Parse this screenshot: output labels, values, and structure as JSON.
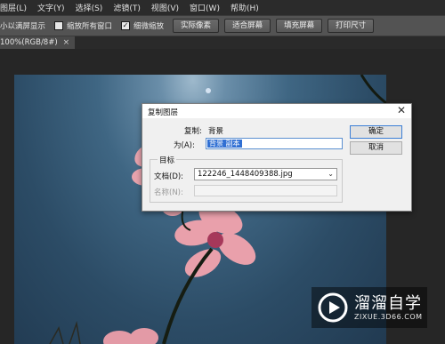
{
  "menu": {
    "items": [
      "图层(L)",
      "文字(Y)",
      "选择(S)",
      "滤镜(T)",
      "视图(V)",
      "窗口(W)",
      "帮助(H)"
    ]
  },
  "options_bar": {
    "scroll_all_label": "小以满屏显示",
    "zoom_all_windows_label": "缩放所有窗口",
    "zoom_all_windows_checked": false,
    "scrubby_zoom_label": "细微缩放",
    "scrubby_zoom_checked": true,
    "buttons": [
      "实际像素",
      "适合屏幕",
      "填充屏幕",
      "打印尺寸"
    ]
  },
  "document_tab": {
    "title": "100%(RGB/8#)",
    "close_glyph": "×"
  },
  "dialog": {
    "title": "复制图层",
    "close_glyph": "✕",
    "source_label": "复制:",
    "source_value": "背景",
    "as_label": "为(A):",
    "as_value": "背景 副本",
    "target_legend": "目标",
    "document_label": "文档(D):",
    "document_value": "122246_1448409388.jpg",
    "name_label": "名称(N):",
    "name_value": "",
    "ok_label": "确定",
    "cancel_label": "取消"
  },
  "watermark": {
    "main_text": "溜溜自学",
    "url_text": "ZIXUE.3D66.COM"
  },
  "colors": {
    "menubar_bg": "#2b2b2b",
    "optbar_bg": "#535353",
    "canvas_sky": "#3f6683",
    "petal_pink": "#e7a3ad",
    "selection_blue": "#2f6fd3"
  }
}
